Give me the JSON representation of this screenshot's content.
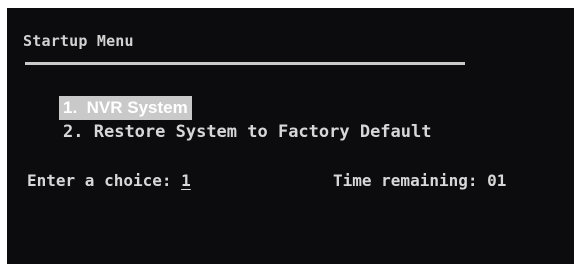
{
  "screen": {
    "title": "Startup Menu",
    "menu_items": [
      {
        "number": "1.",
        "label": "NVR System",
        "selected": true
      },
      {
        "number": "2.",
        "label": "Restore System to Factory Default",
        "selected": false
      }
    ],
    "prompt": {
      "label": "Enter a choice:",
      "value": "1"
    },
    "timer": {
      "label": "Time remaining:",
      "value": "01"
    }
  },
  "colors": {
    "background": "#0c0c0e",
    "text": "#d7d7d7",
    "highlight": "#c9c9c9"
  }
}
